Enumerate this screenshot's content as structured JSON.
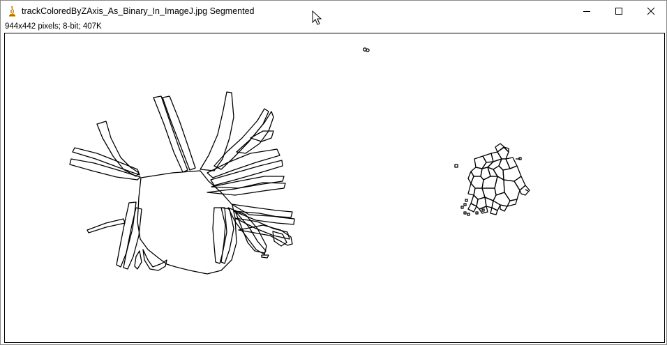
{
  "window": {
    "title": "trackColoredByZAxis_As_Binary_In_ImageJ.jpg Segmented",
    "app_icon": "imagej-microscope-icon",
    "controls": {
      "minimize_icon": "minimize-icon",
      "maximize_icon": "maximize-icon",
      "close_icon": "close-icon"
    }
  },
  "image_info": "944x442 pixels; 8-bit; 407K",
  "image": {
    "content": "binary segmented outlines",
    "foreground_color": "#000000",
    "background_color": "#ffffff"
  },
  "cursor_icon": "arrow-cursor-icon"
}
